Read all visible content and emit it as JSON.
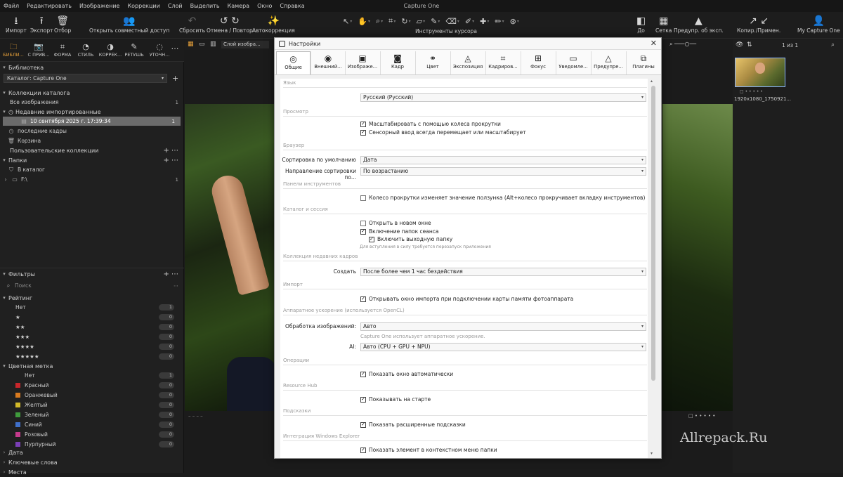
{
  "app_title": "Capture One",
  "menu": [
    "Файл",
    "Редактировать",
    "Изображение",
    "Коррекции",
    "Слой",
    "Выделить",
    "Камера",
    "Окно",
    "Справка"
  ],
  "toolbar": {
    "import": "Импорт",
    "export": "Экспорт",
    "select": "Отбор",
    "share": "Открыть совместный доступ",
    "reset": "Сбросить",
    "undo_redo": "Отмена / Повтор",
    "autocorrect": "Автокоррекция",
    "cursor_tools": "Инструменты курсора",
    "before": "До",
    "grid": "Сетка",
    "exposure_warn": "Предупр. об эксп.",
    "copy_apply": "Копир./Примен.",
    "account": "My Capture One"
  },
  "tool_tabs": [
    "БИБЛИ...",
    "С ПРИВ...",
    "ФОРМА",
    "СТИЛЬ",
    "КОРРЕК...",
    "РЕТУШЬ",
    "УТОЧН..."
  ],
  "library": {
    "title": "Библиотека",
    "catalog": "Каталог: Capture One",
    "catalog_collections": "Коллекции каталога",
    "all_images": "Все изображения",
    "all_images_count": "1",
    "recent_imports": "Недавние импортированные",
    "recent_date": "10 сентября 2025 г. 17:39:34",
    "recent_count": "1",
    "recent_captures": "последние кадры",
    "trash": "Корзина",
    "user_collections": "Пользовательские коллекции",
    "folders": "Папки",
    "in_catalog": "В каталог",
    "drive": "F:\\",
    "drive_count": "1"
  },
  "filters": {
    "title": "Фильтры",
    "search_placeholder": "Поиск",
    "rating": "Рейтинг",
    "rating_rows": [
      {
        "label": "Нет",
        "count": "1"
      },
      {
        "label": "★",
        "count": "0"
      },
      {
        "label": "★★",
        "count": "0"
      },
      {
        "label": "★★★",
        "count": "0"
      },
      {
        "label": "★★★★",
        "count": "0"
      },
      {
        "label": "★★★★★",
        "count": "0"
      }
    ],
    "color_label": "Цветная метка",
    "color_rows": [
      {
        "label": "Нет",
        "count": "1",
        "color": ""
      },
      {
        "label": "Красный",
        "count": "0",
        "color": "#c8262b"
      },
      {
        "label": "Оранжевый",
        "count": "0",
        "color": "#d97a1f"
      },
      {
        "label": "Желтый",
        "count": "0",
        "color": "#d2b928"
      },
      {
        "label": "Зеленый",
        "count": "0",
        "color": "#3f9b3c"
      },
      {
        "label": "Синий",
        "count": "0",
        "color": "#3f6fc9"
      },
      {
        "label": "Розовый",
        "count": "0",
        "color": "#c53a8c"
      },
      {
        "label": "Пурпурный",
        "count": "0",
        "color": "#7a3fb6"
      }
    ],
    "date": "Дата",
    "keywords": "Ключевые слова",
    "places": "Места"
  },
  "viewer": {
    "layer_select": "Слой изобра...",
    "page_counter": "1 из 1",
    "thumb_caption": "1920x1080_1750921..."
  },
  "watermark": "Allrepack.Ru",
  "dialog": {
    "title": "Настройки",
    "tabs": [
      "Общие",
      "Внешний...",
      "Изображе...",
      "Кадр",
      "Цвет",
      "Экспозиция",
      "Кадриров...",
      "Фокус",
      "Уведомле...",
      "Предупре...",
      "Плагины"
    ],
    "language": {
      "group": "Язык",
      "value": "Русский (Русский)"
    },
    "view": {
      "group": "Просмотр",
      "opt1": "Масштабировать с помощью колеса прокрутки",
      "opt2": "Сенсорный ввод всегда перемещает или масштабирует"
    },
    "browser": {
      "group": "Браузер",
      "sort_label": "Сортировка по умолчанию",
      "sort_value": "Дата",
      "dir_label": "Направление сортировки по...",
      "dir_value": "По возрастанию"
    },
    "tools_panel": {
      "group": "Панели инструментов",
      "opt1": "Колесо прокрутки изменяет значение ползунка (Alt+колесо прокручивает вкладку инструментов)"
    },
    "catalog_session": {
      "group": "Каталог и сессия",
      "opt1": "Открыть в новом окне",
      "opt2": "Включение папок сеанса",
      "opt3": "Включить выходную папку",
      "hint": "Для вступления в силу требуется перезапуск приложения"
    },
    "recent_captures": {
      "group": "Коллекция недавних кадров",
      "create_label": "Создать",
      "create_value": "После более чем 1 час бездействия"
    },
    "import": {
      "group": "Импорт",
      "opt1": "Открывать окно импорта при подключении карты памяти фотоаппарата"
    },
    "hw_accel": {
      "group": "Аппаратное ускорение (используется OpenCL)",
      "proc_label": "Обработка изображений:",
      "proc_value": "Авто",
      "note": "Capture One использует аппаратное ускорение.",
      "ai_label": "AI:",
      "ai_value": "Авто (CPU + GPU + NPU)"
    },
    "operations": {
      "group": "Операции",
      "opt1": "Показать окно автоматически"
    },
    "resource_hub": {
      "group": "Resource Hub",
      "opt1": "Показывать на старте"
    },
    "tips": {
      "group": "Подсказки",
      "opt1": "Показать расширенные подсказки"
    },
    "explorer": {
      "group": "Интеграция Windows Explorer",
      "opt1": "Показать элемент в контекстном меню папки"
    }
  }
}
